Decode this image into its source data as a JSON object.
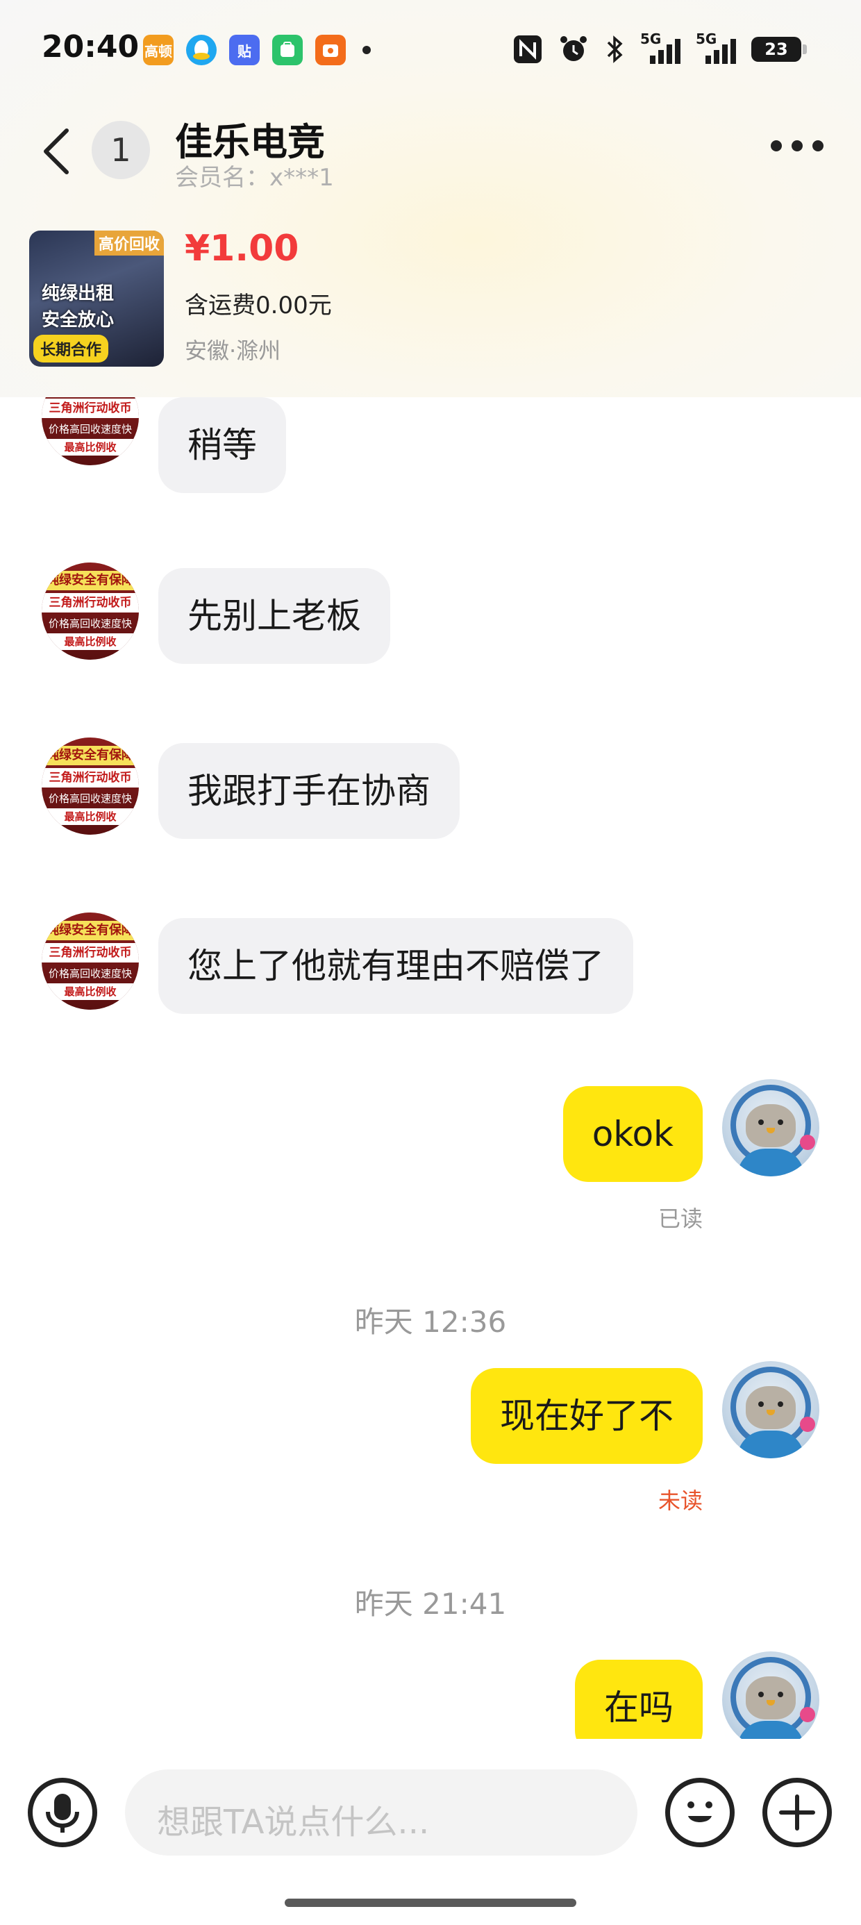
{
  "status_bar": {
    "time": "20:40",
    "apps": [
      {
        "icon": "gaode-icon",
        "color": "#f29c1f",
        "label": "高顿"
      },
      {
        "icon": "qq-icon",
        "color": "#1fa7f0",
        "label": ""
      },
      {
        "icon": "tieba-icon",
        "color": "#4c6cf0",
        "label": "贴"
      },
      {
        "icon": "wechat-mini-icon",
        "color": "#2cc36b",
        "label": ""
      },
      {
        "icon": "taobao-icon",
        "color": "#f36c1a",
        "label": ""
      }
    ],
    "network_1": "5G",
    "network_2": "5G",
    "battery": "23"
  },
  "header": {
    "unread_count": "1",
    "title": "佳乐电竞",
    "subtitle": "会员名：x***1"
  },
  "product": {
    "image_tag": "高价回收",
    "image_line1": "纯绿出租",
    "image_line2": "安全放心",
    "image_badge": "长期合作",
    "price": "¥1.00",
    "shipping": "含运费0.00元",
    "location": "安徽·滁州"
  },
  "avatar_shop": {
    "line1": "纯绿安全有保障",
    "line2": "三角洲行动收币",
    "line3": "价格高回收速度快",
    "line4": "最高比例收"
  },
  "messages": [
    {
      "side": "in",
      "text": "稍等"
    },
    {
      "side": "in",
      "text": "先别上老板"
    },
    {
      "side": "in",
      "text": "我跟打手在协商"
    },
    {
      "side": "in",
      "text": "您上了他就有理由不赔偿了"
    },
    {
      "side": "out",
      "text": "okok",
      "status": "已读"
    },
    {
      "side": "time",
      "text": "昨天 12:36"
    },
    {
      "side": "out",
      "text": "现在好了不",
      "status": "未读"
    },
    {
      "side": "time",
      "text": "昨天 21:41"
    },
    {
      "side": "out",
      "text": "在吗"
    }
  ],
  "input": {
    "placeholder": "想跟TA说点什么..."
  },
  "colors": {
    "price": "#f23b3b",
    "bubble_out": "#ffe60f",
    "bubble_in": "#f1f1f3",
    "read_status": "#999999",
    "unread_status": "#e8542c"
  }
}
